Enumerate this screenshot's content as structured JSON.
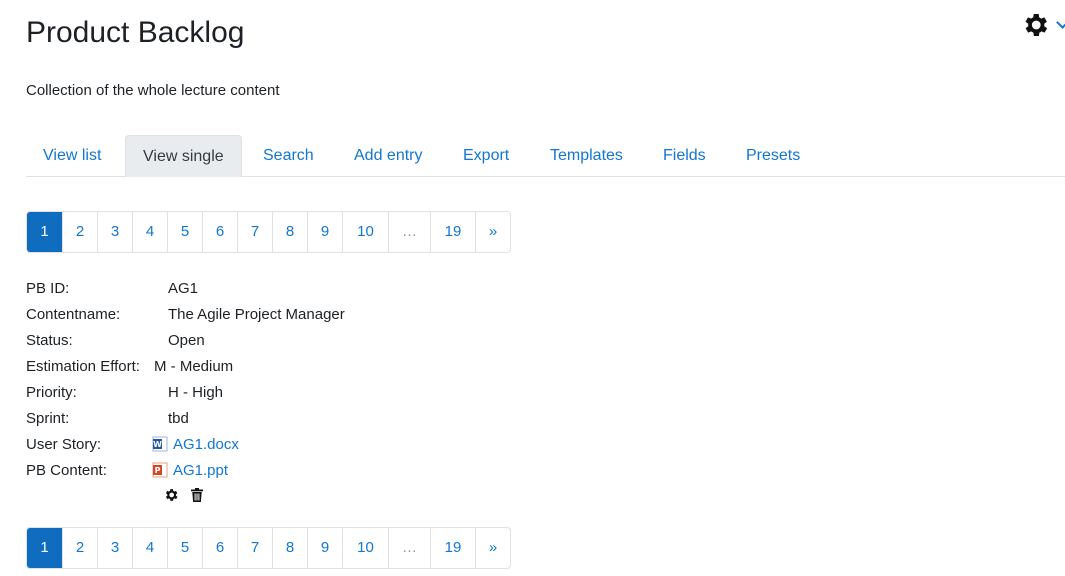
{
  "header": {
    "title": "Product Backlog",
    "description": "Collection of the whole lecture content"
  },
  "tabs": [
    {
      "label": "View list",
      "active": false
    },
    {
      "label": "View single",
      "active": true
    },
    {
      "label": "Search",
      "active": false
    },
    {
      "label": "Add entry",
      "active": false
    },
    {
      "label": "Export",
      "active": false
    },
    {
      "label": "Templates",
      "active": false
    },
    {
      "label": "Fields",
      "active": false
    },
    {
      "label": "Presets",
      "active": false
    }
  ],
  "pagination": {
    "items": [
      "1",
      "2",
      "3",
      "4",
      "5",
      "6",
      "7",
      "8",
      "9",
      "10",
      "…",
      "19",
      "»"
    ],
    "current": "1"
  },
  "entry": {
    "pb_id": {
      "label": "PB ID:",
      "value": "AG1"
    },
    "contentname": {
      "label": "Contentname:",
      "value": "The Agile Project Manager"
    },
    "status": {
      "label": "Status:",
      "value": "Open"
    },
    "estimation": {
      "label": "Estimation Effort:",
      "value": "M - Medium"
    },
    "priority": {
      "label": "Priority:",
      "value": "H - High"
    },
    "sprint": {
      "label": "Sprint:",
      "value": "tbd"
    },
    "user_story": {
      "label": "User Story:",
      "value": "AG1.docx",
      "icon": "word-document-icon"
    },
    "pb_content": {
      "label": "PB Content:",
      "value": "AG1.ppt",
      "icon": "powerpoint-document-icon"
    }
  },
  "colors": {
    "link": "#1177d1",
    "active_page": "#0f6cbf",
    "text": "#1d2125"
  }
}
